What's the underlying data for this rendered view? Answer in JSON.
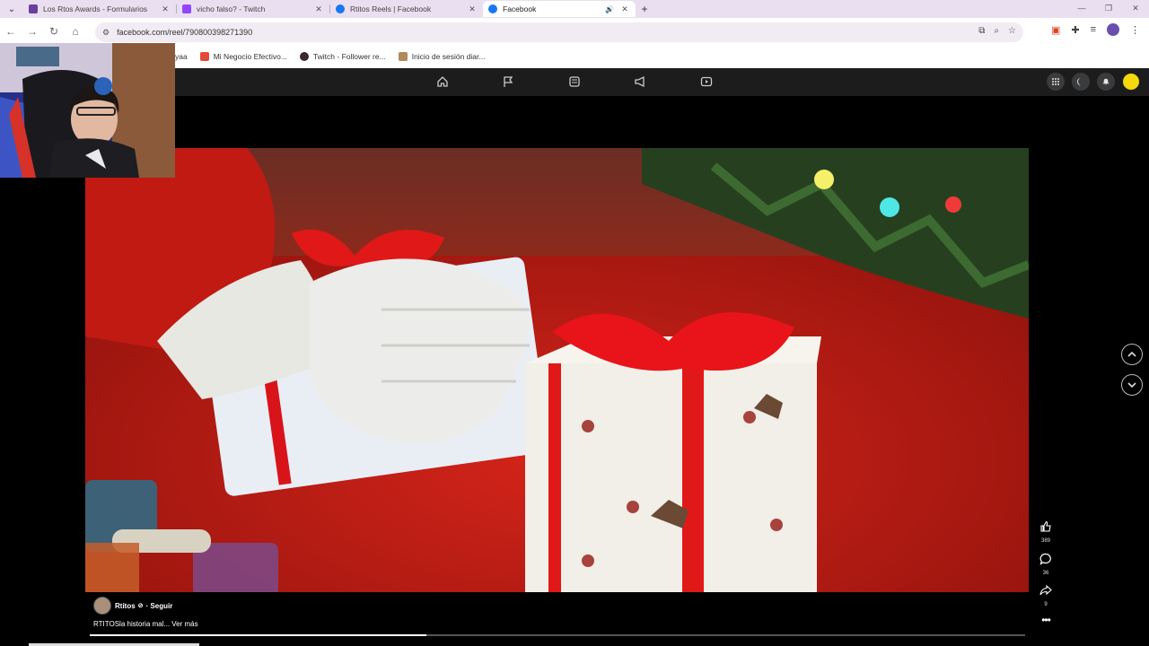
{
  "browser": {
    "tabs": [
      {
        "title": "Los Rtos Awards - Formularios",
        "icon": "forms-icon",
        "color": "#6b3fa0",
        "active": false
      },
      {
        "title": "vicho falso? - Twitch",
        "icon": "twitch-icon",
        "color": "#9146ff",
        "active": false
      },
      {
        "title": "Rtitos Reels | Facebook",
        "icon": "facebook-icon",
        "color": "#1877f2",
        "active": false
      },
      {
        "title": "Facebook",
        "icon": "facebook-icon",
        "color": "#1877f2",
        "active": true
      }
    ],
    "url": "facebook.com/reel/790800398271390",
    "bookmarks": [
      {
        "label": "yaa",
        "color": ""
      },
      {
        "label": "Mi Negocio Efectivo...",
        "color": "#e24b3a"
      },
      {
        "label": "Twitch - Follower re...",
        "color": "#3b2a2a"
      },
      {
        "label": "Inicio de sesión diar...",
        "color": "#b08a5a"
      }
    ]
  },
  "reel": {
    "likes": "389",
    "comments": "36",
    "shares": "9",
    "author": "Rtitos",
    "follow": "· Seguir",
    "caption": "RTITOSla historia mal... Ver más",
    "progress_fraction": 0.36
  },
  "colors": {
    "tab_strip": "#e9dff0",
    "fb_bar": "#1c1c1d",
    "video_red": "#b51810"
  }
}
